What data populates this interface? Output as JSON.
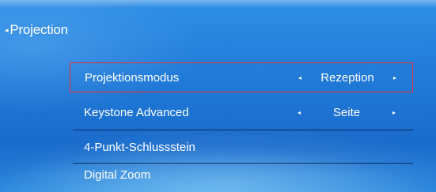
{
  "header": {
    "back_arrow": "◂",
    "title": "Projection"
  },
  "menu": {
    "items": [
      {
        "label": "Projektionsmodus",
        "value": "Rezeption",
        "selected": true
      },
      {
        "label": "Keystone Advanced",
        "value": "Seite",
        "selected": false
      },
      {
        "label": "4-Punkt-Schlussstein"
      },
      {
        "label": "Digital Zoom"
      }
    ],
    "arrow_left": "◂",
    "arrow_right": "▸"
  },
  "colors": {
    "selection_border": "#e23434",
    "background": "#1f78d6",
    "text": "#ffffff"
  }
}
